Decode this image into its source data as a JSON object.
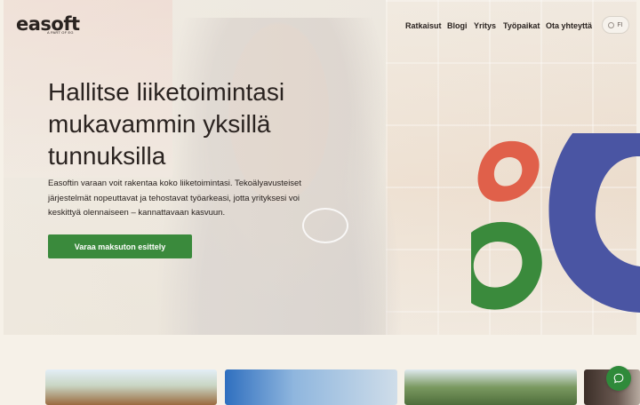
{
  "header": {
    "logo": "easoft",
    "logo_sub": "A PART OF EG",
    "nav": [
      {
        "label": "Ratkaisut"
      },
      {
        "label": "Blogi"
      },
      {
        "label": "Yritys"
      },
      {
        "label": "Työpaikat"
      },
      {
        "label": "Ota yhteyttä"
      }
    ],
    "language": "FI"
  },
  "hero": {
    "title": "Hallitse liiketoimintasi mukavammin yksillä tunnuksilla",
    "description": "Easoftin varaan voit rakentaa koko liiketoimintasi. Tekoälyavusteiset järjestelmät nopeuttavat ja tehostavat työarkeasi, jotta yrityksesi voi keskittyä olennaiseen – kannattavaan kasvuun.",
    "cta_label": "Varaa maksuton esittely"
  },
  "colors": {
    "accent_green": "#3a8a3c",
    "shape_red": "#e0604a",
    "shape_blue": "#4a55a3",
    "shape_green": "#3a8a3c",
    "background": "#f6f1e8"
  },
  "icons": {
    "language": "globe-icon",
    "chat": "chat-bubble-icon"
  }
}
